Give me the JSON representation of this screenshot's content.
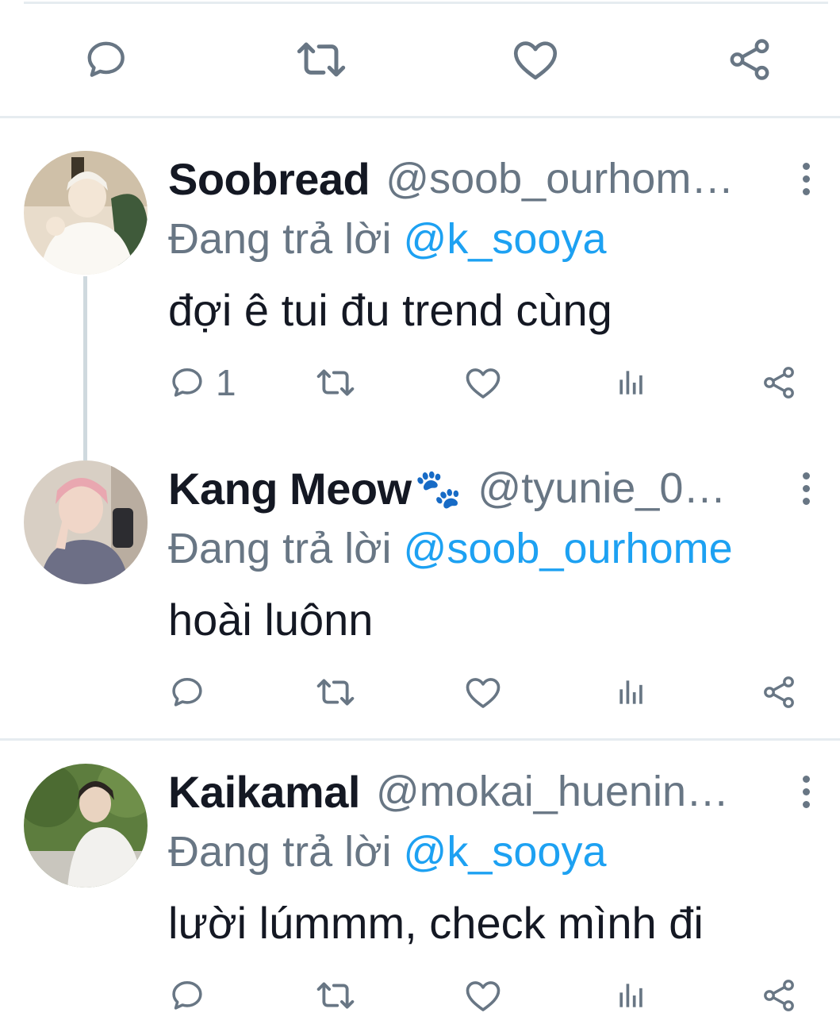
{
  "top_actions": {
    "reply_icon": "speech-bubble-icon",
    "retweet_icon": "retweet-icon",
    "like_icon": "heart-icon",
    "share_icon": "share-icon"
  },
  "tweets": [
    {
      "name": "Soobread",
      "emoji": "",
      "handle": "@soob_ourhom…",
      "replying_prefix": "Đang trả lời",
      "replying_to": "@k_sooya",
      "text": "đợi ê tui đu trend cùng",
      "reply_count": "1",
      "retweet_count": "",
      "like_count": ""
    },
    {
      "name": "Kang Meow",
      "emoji": "🐾",
      "handle": "@tyunie_0…",
      "replying_prefix": "Đang trả lời",
      "replying_to": "@soob_ourhome",
      "text": "hoài luônn",
      "reply_count": "",
      "retweet_count": "",
      "like_count": ""
    },
    {
      "name": "Kaikamal",
      "emoji": "",
      "handle": "@mokai_huenin…",
      "replying_prefix": "Đang trả lời",
      "replying_to": "@k_sooya",
      "text": "lười lúmmm, check mình đi",
      "reply_count": "",
      "retweet_count": "",
      "like_count": ""
    }
  ],
  "colors": {
    "text": "#141823",
    "secondary": "#687684",
    "link": "#1da1f2",
    "divider": "#e6ecf0"
  }
}
